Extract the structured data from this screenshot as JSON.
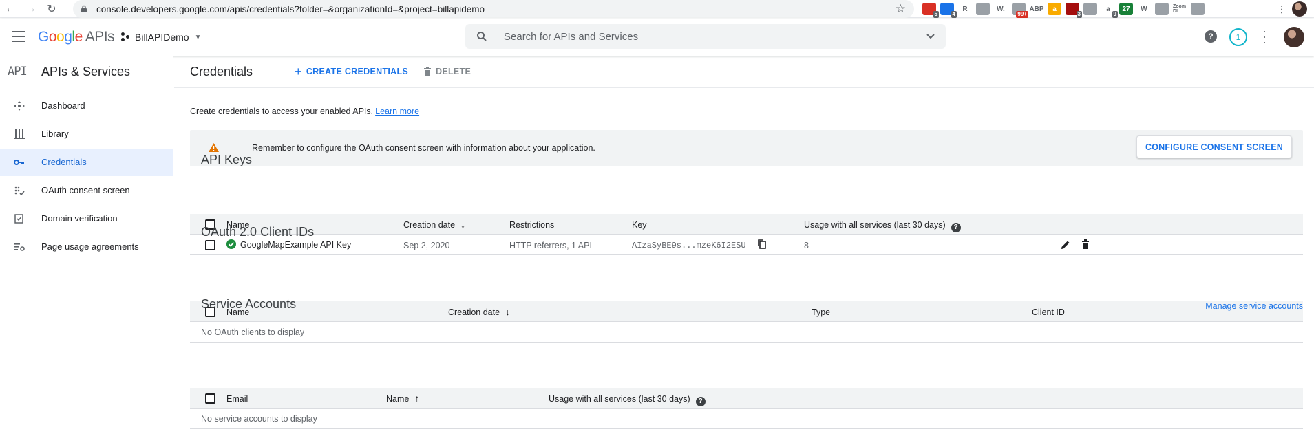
{
  "browser": {
    "url": "console.developers.google.com/apis/credentials?folder=&organizationId=&project=billapidemo",
    "extensions": [
      {
        "name": "pdf-ext-icon",
        "color": "#d93025",
        "label": "",
        "badge": "5"
      },
      {
        "name": "trello-ext-icon",
        "color": "#1a73e8",
        "label": "",
        "badge": "4"
      },
      {
        "name": "r-ext-icon",
        "color": "#ffffff",
        "label": "R",
        "badge": ""
      },
      {
        "name": "folder-ext-icon",
        "color": "#ffffff",
        "label": "",
        "badge": ""
      },
      {
        "name": "w-ext-icon",
        "color": "#ffffff",
        "label": "W.",
        "badge": ""
      },
      {
        "name": "mail-ext-icon",
        "color": "#ffffff",
        "label": "",
        "badge": "99+"
      },
      {
        "name": "abp-ext-icon",
        "color": "#ffffff",
        "label": "ABP",
        "badge": ""
      },
      {
        "name": "amazon-ext-icon",
        "color": "#f9ab00",
        "label": "a",
        "badge": ""
      },
      {
        "name": "shield-ext-icon",
        "color": "#a50e0e",
        "label": "",
        "badge": "3"
      },
      {
        "name": "grey-ext-icon",
        "color": "#dadce0",
        "label": "",
        "badge": ""
      },
      {
        "name": "a-ext-icon",
        "color": "#ffffff",
        "label": "a",
        "badge": "9"
      },
      {
        "name": "calendar-ext-icon",
        "color": "#188038",
        "label": "27",
        "badge": ""
      },
      {
        "name": "wp-ext-icon",
        "color": "#ffffff",
        "label": "W",
        "badge": ""
      },
      {
        "name": "camera-ext-icon",
        "color": "#ffffff",
        "label": "",
        "badge": ""
      },
      {
        "name": "zoom-ext-icon",
        "color": "#ffffff",
        "label": "Zoom DL",
        "badge": ""
      },
      {
        "name": "puzzle-ext-icon",
        "color": "#ffffff",
        "label": "",
        "badge": ""
      }
    ]
  },
  "header": {
    "product": "APIs",
    "project_name": "BillAPIDemo",
    "search_placeholder": "Search for APIs and Services",
    "notification_count": "1",
    "help_glyph": "?"
  },
  "sidebar": {
    "mark": "API",
    "title": "APIs & Services",
    "items": [
      {
        "label": "Dashboard",
        "icon": "dashboard-icon"
      },
      {
        "label": "Library",
        "icon": "library-icon"
      },
      {
        "label": "Credentials",
        "icon": "key-icon",
        "active": true
      },
      {
        "label": "OAuth consent screen",
        "icon": "consent-icon"
      },
      {
        "label": "Domain verification",
        "icon": "domain-check-icon"
      },
      {
        "label": "Page usage agreements",
        "icon": "settings-list-icon"
      }
    ]
  },
  "toolbar": {
    "title": "Credentials",
    "create_label": "CREATE CREDENTIALS",
    "delete_label": "DELETE"
  },
  "intro": {
    "text": "Create credentials to access your enabled APIs.",
    "link": "Learn more"
  },
  "banner": {
    "text": "Remember to configure the OAuth consent screen with information about your application.",
    "button": "CONFIGURE CONSENT SCREEN",
    "warning_color": "#e37400"
  },
  "api_keys": {
    "title": "API Keys",
    "columns": [
      "Name",
      "Creation date",
      "Restrictions",
      "Key",
      "Usage with all services (last 30 days)"
    ],
    "rows": [
      {
        "name": "GoogleMapExample API Key",
        "created": "Sep 2, 2020",
        "restrictions": "HTTP referrers, 1 API",
        "key": "AIzaSyBE9s...mzeK6I2ESU",
        "usage": "8"
      }
    ]
  },
  "oauth": {
    "title": "OAuth 2.0 Client IDs",
    "columns": [
      "Name",
      "Creation date",
      "Type",
      "Client ID"
    ],
    "empty": "No OAuth clients to display"
  },
  "service_accounts": {
    "title": "Service Accounts",
    "manage_link": "Manage service accounts",
    "columns": [
      "Email",
      "Name",
      "Usage with all services (last 30 days)"
    ],
    "empty": "No service accounts to display"
  },
  "colors": {
    "accent": "#1a73e8",
    "success": "#1e8e3e",
    "active_bg": "#e8f0fe"
  }
}
